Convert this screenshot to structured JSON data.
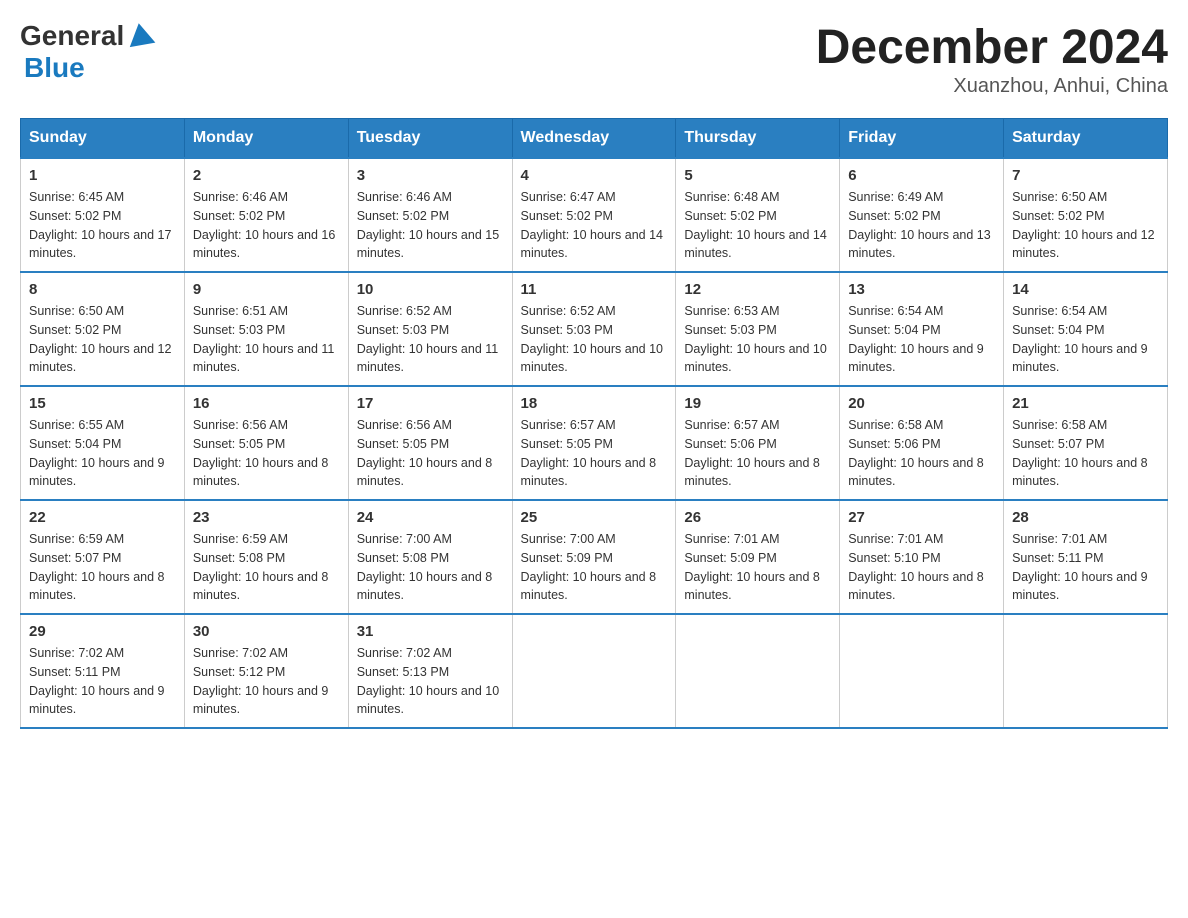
{
  "header": {
    "logo_general": "General",
    "logo_blue": "Blue",
    "month_title": "December 2024",
    "subtitle": "Xuanzhou, Anhui, China"
  },
  "calendar": {
    "days_of_week": [
      "Sunday",
      "Monday",
      "Tuesday",
      "Wednesday",
      "Thursday",
      "Friday",
      "Saturday"
    ],
    "weeks": [
      [
        {
          "day": "1",
          "sunrise": "6:45 AM",
          "sunset": "5:02 PM",
          "daylight": "10 hours and 17 minutes."
        },
        {
          "day": "2",
          "sunrise": "6:46 AM",
          "sunset": "5:02 PM",
          "daylight": "10 hours and 16 minutes."
        },
        {
          "day": "3",
          "sunrise": "6:46 AM",
          "sunset": "5:02 PM",
          "daylight": "10 hours and 15 minutes."
        },
        {
          "day": "4",
          "sunrise": "6:47 AM",
          "sunset": "5:02 PM",
          "daylight": "10 hours and 14 minutes."
        },
        {
          "day": "5",
          "sunrise": "6:48 AM",
          "sunset": "5:02 PM",
          "daylight": "10 hours and 14 minutes."
        },
        {
          "day": "6",
          "sunrise": "6:49 AM",
          "sunset": "5:02 PM",
          "daylight": "10 hours and 13 minutes."
        },
        {
          "day": "7",
          "sunrise": "6:50 AM",
          "sunset": "5:02 PM",
          "daylight": "10 hours and 12 minutes."
        }
      ],
      [
        {
          "day": "8",
          "sunrise": "6:50 AM",
          "sunset": "5:02 PM",
          "daylight": "10 hours and 12 minutes."
        },
        {
          "day": "9",
          "sunrise": "6:51 AM",
          "sunset": "5:03 PM",
          "daylight": "10 hours and 11 minutes."
        },
        {
          "day": "10",
          "sunrise": "6:52 AM",
          "sunset": "5:03 PM",
          "daylight": "10 hours and 11 minutes."
        },
        {
          "day": "11",
          "sunrise": "6:52 AM",
          "sunset": "5:03 PM",
          "daylight": "10 hours and 10 minutes."
        },
        {
          "day": "12",
          "sunrise": "6:53 AM",
          "sunset": "5:03 PM",
          "daylight": "10 hours and 10 minutes."
        },
        {
          "day": "13",
          "sunrise": "6:54 AM",
          "sunset": "5:04 PM",
          "daylight": "10 hours and 9 minutes."
        },
        {
          "day": "14",
          "sunrise": "6:54 AM",
          "sunset": "5:04 PM",
          "daylight": "10 hours and 9 minutes."
        }
      ],
      [
        {
          "day": "15",
          "sunrise": "6:55 AM",
          "sunset": "5:04 PM",
          "daylight": "10 hours and 9 minutes."
        },
        {
          "day": "16",
          "sunrise": "6:56 AM",
          "sunset": "5:05 PM",
          "daylight": "10 hours and 8 minutes."
        },
        {
          "day": "17",
          "sunrise": "6:56 AM",
          "sunset": "5:05 PM",
          "daylight": "10 hours and 8 minutes."
        },
        {
          "day": "18",
          "sunrise": "6:57 AM",
          "sunset": "5:05 PM",
          "daylight": "10 hours and 8 minutes."
        },
        {
          "day": "19",
          "sunrise": "6:57 AM",
          "sunset": "5:06 PM",
          "daylight": "10 hours and 8 minutes."
        },
        {
          "day": "20",
          "sunrise": "6:58 AM",
          "sunset": "5:06 PM",
          "daylight": "10 hours and 8 minutes."
        },
        {
          "day": "21",
          "sunrise": "6:58 AM",
          "sunset": "5:07 PM",
          "daylight": "10 hours and 8 minutes."
        }
      ],
      [
        {
          "day": "22",
          "sunrise": "6:59 AM",
          "sunset": "5:07 PM",
          "daylight": "10 hours and 8 minutes."
        },
        {
          "day": "23",
          "sunrise": "6:59 AM",
          "sunset": "5:08 PM",
          "daylight": "10 hours and 8 minutes."
        },
        {
          "day": "24",
          "sunrise": "7:00 AM",
          "sunset": "5:08 PM",
          "daylight": "10 hours and 8 minutes."
        },
        {
          "day": "25",
          "sunrise": "7:00 AM",
          "sunset": "5:09 PM",
          "daylight": "10 hours and 8 minutes."
        },
        {
          "day": "26",
          "sunrise": "7:01 AM",
          "sunset": "5:09 PM",
          "daylight": "10 hours and 8 minutes."
        },
        {
          "day": "27",
          "sunrise": "7:01 AM",
          "sunset": "5:10 PM",
          "daylight": "10 hours and 8 minutes."
        },
        {
          "day": "28",
          "sunrise": "7:01 AM",
          "sunset": "5:11 PM",
          "daylight": "10 hours and 9 minutes."
        }
      ],
      [
        {
          "day": "29",
          "sunrise": "7:02 AM",
          "sunset": "5:11 PM",
          "daylight": "10 hours and 9 minutes."
        },
        {
          "day": "30",
          "sunrise": "7:02 AM",
          "sunset": "5:12 PM",
          "daylight": "10 hours and 9 minutes."
        },
        {
          "day": "31",
          "sunrise": "7:02 AM",
          "sunset": "5:13 PM",
          "daylight": "10 hours and 10 minutes."
        },
        null,
        null,
        null,
        null
      ]
    ]
  }
}
